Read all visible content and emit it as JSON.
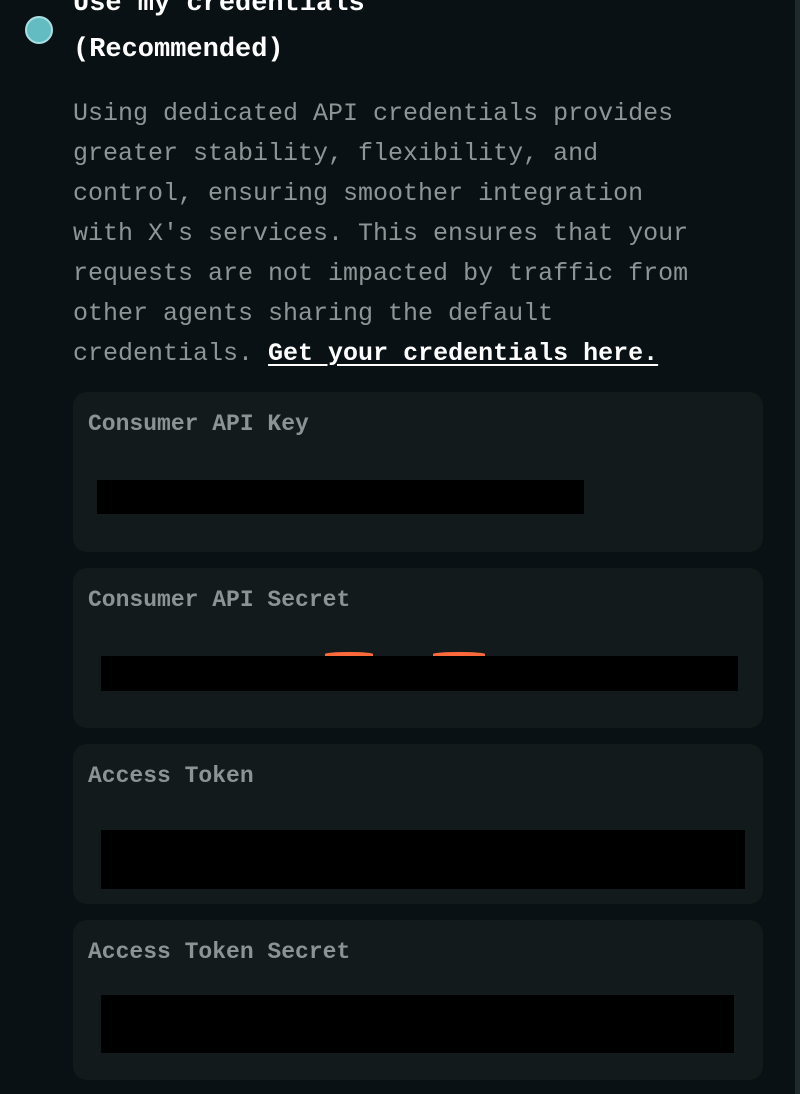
{
  "option": {
    "title_line1": "Use my credentials",
    "title_line2": "(Recommended)",
    "selected": true,
    "description_lines": [
      "Using dedicated API credentials provides",
      "greater stability, flexibility, and",
      "control, ensuring smoother integration",
      "with X's services. This ensures that your",
      "requests are not impacted by traffic from",
      "other agents sharing the default"
    ],
    "description_last": "credentials. ",
    "link_label": "Get your credentials here."
  },
  "fields": {
    "consumer_key": {
      "label": "Consumer API Key",
      "value": ""
    },
    "consumer_secret": {
      "label": "Consumer API Secret",
      "value": ""
    },
    "access_token": {
      "label": "Access Token",
      "value": ""
    },
    "access_token_secret": {
      "label": "Access Token Secret",
      "value": ""
    }
  },
  "colors": {
    "background": "#0a1114",
    "card": "#121a1b",
    "radio_fill": "#64bcc3",
    "title_text": "#ffffff",
    "muted_text": "#8e9597",
    "field_redacted": "#000000"
  }
}
